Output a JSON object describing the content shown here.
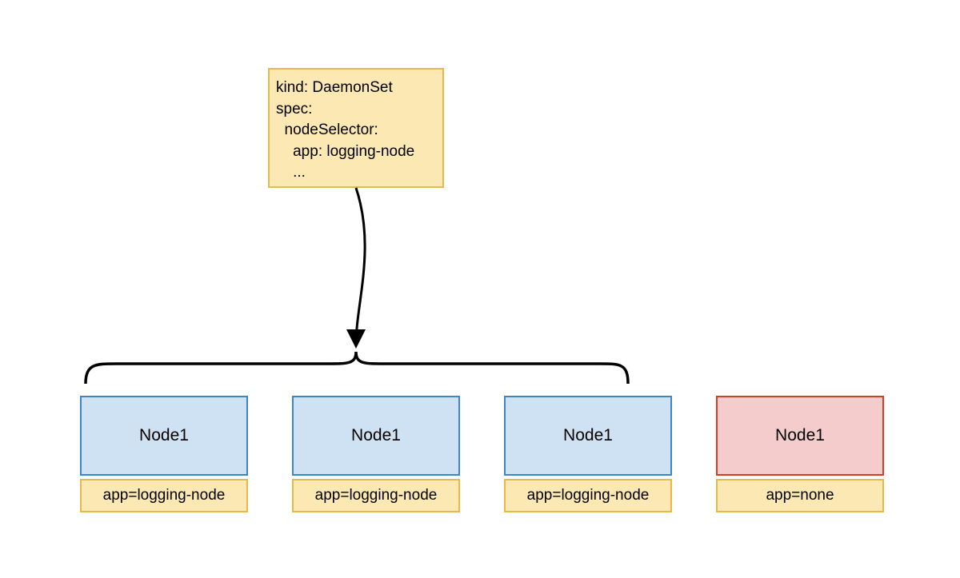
{
  "spec": {
    "line1": "kind: DaemonSet",
    "line2": "spec:",
    "line3": "  nodeSelector:",
    "line4": "    app: logging-node",
    "line5": "    ..."
  },
  "nodes": [
    {
      "title": "Node1",
      "label": "app=logging-node",
      "matched": true
    },
    {
      "title": "Node1",
      "label": "app=logging-node",
      "matched": true
    },
    {
      "title": "Node1",
      "label": "app=logging-node",
      "matched": true
    },
    {
      "title": "Node1",
      "label": "app=none",
      "matched": false
    }
  ]
}
